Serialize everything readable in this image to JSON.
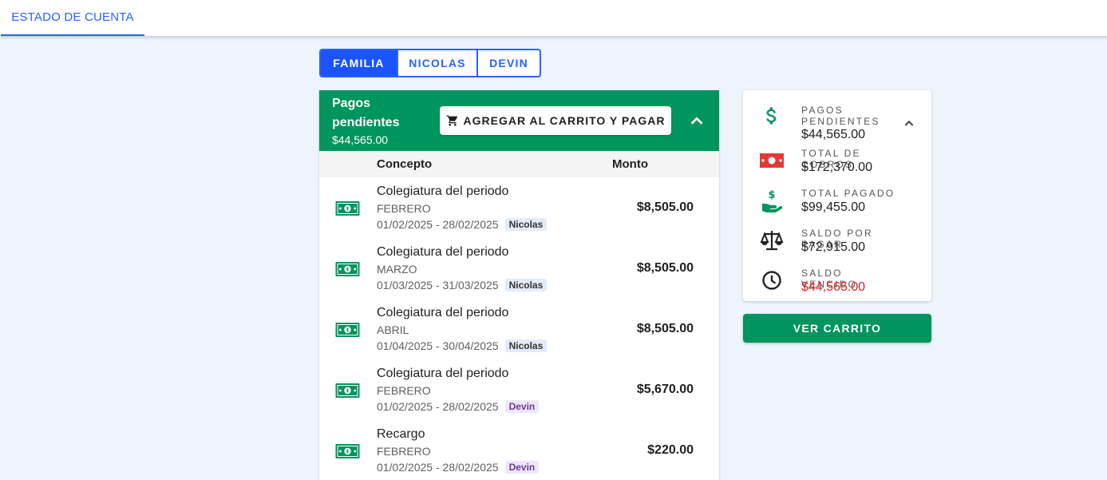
{
  "topbar": {
    "tab_label": "ESTADO DE CUENTA"
  },
  "toggle": {
    "options": [
      "FAMILIA",
      "NICOLAS",
      "DEVIN"
    ],
    "selected": "FAMILIA"
  },
  "pending": {
    "title": "Pagos pendientes",
    "amount": "$44,565.00",
    "cart_button_label": "AGREGAR AL CARRITO Y PAGAR",
    "icons": {
      "cart": "cart-icon",
      "collapse": "chevron-up-icon",
      "row": "cash-icon"
    },
    "columns": {
      "concept": "Concepto",
      "amount": "Monto"
    },
    "rows": [
      {
        "concept": "Colegiatura del periodo",
        "period": "FEBRERO",
        "range": "01/02/2025 - 28/02/2025",
        "student": "Nicolas",
        "amount": "$8,505.00"
      },
      {
        "concept": "Colegiatura del periodo",
        "period": "MARZO",
        "range": "01/03/2025 - 31/03/2025",
        "student": "Nicolas",
        "amount": "$8,505.00"
      },
      {
        "concept": "Colegiatura del periodo",
        "period": "ABRIL",
        "range": "01/04/2025 - 30/04/2025",
        "student": "Nicolas",
        "amount": "$8,505.00"
      },
      {
        "concept": "Colegiatura del periodo",
        "period": "FEBRERO",
        "range": "01/02/2025 - 28/02/2025",
        "student": "Devin",
        "amount": "$5,670.00"
      },
      {
        "concept": "Recargo",
        "period": "FEBRERO",
        "range": "01/02/2025 - 28/02/2025",
        "student": "Devin",
        "amount": "$220.00"
      }
    ]
  },
  "summary": {
    "items": [
      {
        "label": "PAGOS PENDIENTES",
        "value": "$44,565.00",
        "icon": "dollar-icon"
      },
      {
        "label": "TOTAL DE COBROS",
        "value": "$172,370.00",
        "icon": "bill-icon"
      },
      {
        "label": "TOTAL PAGADO",
        "value": "$99,455.00",
        "icon": "hand-coin-icon"
      },
      {
        "label": "SALDO POR PAGAR",
        "value": "$72,915.00",
        "icon": "scale-icon"
      },
      {
        "label": "SALDO VENCIDO",
        "value": "$44,565.00",
        "icon": "clock-icon"
      }
    ],
    "colors": {
      "green": "#00945e",
      "red": "#e02020",
      "blue": "#2962ff"
    }
  },
  "ver_carrito_label": "VER CARRITO"
}
